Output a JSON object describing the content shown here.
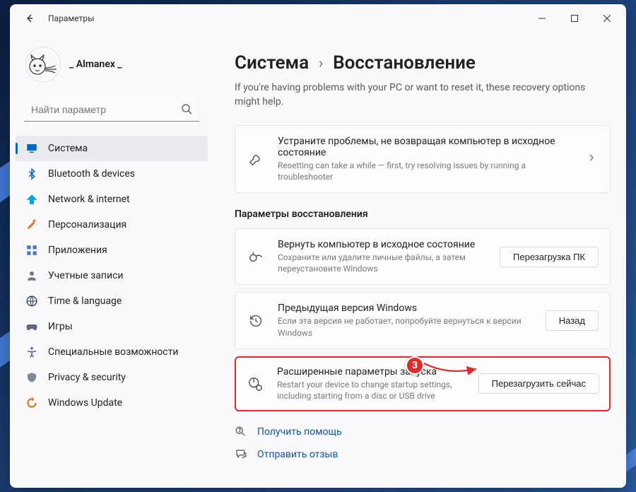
{
  "window": {
    "title": "Параметры",
    "profile_name": "_ Almanex _",
    "search_placeholder": "Найти параметр"
  },
  "sidebar": {
    "items": [
      {
        "icon": "system",
        "label": "Система",
        "active": true,
        "color": "#0067c0"
      },
      {
        "icon": "bluetooth",
        "label": "Bluetooth & devices",
        "color": "#0067c0"
      },
      {
        "icon": "wifi",
        "label": "Network & internet",
        "color": "#00a4e6"
      },
      {
        "icon": "brush",
        "label": "Персонализация",
        "color": "#d97b2f"
      },
      {
        "icon": "apps",
        "label": "Приложения",
        "color": "#4a74c9"
      },
      {
        "icon": "user",
        "label": "Учетные записи",
        "color": "#6b7b8f"
      },
      {
        "icon": "globe",
        "label": "Time & language",
        "color": "#3a4a6f"
      },
      {
        "icon": "game",
        "label": "Игры",
        "color": "#5c6b7a"
      },
      {
        "icon": "access",
        "label": "Специальные возможности",
        "color": "#5a6aa8"
      },
      {
        "icon": "shield",
        "label": "Privacy & security",
        "color": "#7a8a9a"
      },
      {
        "icon": "update",
        "label": "Windows Update",
        "color": "#d97b2f"
      }
    ]
  },
  "breadcrumb": {
    "root": "Система",
    "current": "Восстановление"
  },
  "subtitle": "If you're having problems with your PC or want to reset it, these recovery options might help.",
  "troubleshoot": {
    "title": "Устраните проблемы, не возвращая компьютер в исходное состояние",
    "desc": "Resetting can take a while — first, try resolving issues by running a troubleshooter"
  },
  "recovery_section_title": "Параметры восстановления",
  "cards": [
    {
      "title": "Вернуть компьютер в исходное состояние",
      "desc": "Сохраните или удалите личные файлы, а затем переустановите Windows",
      "button": "Перезагрузка ПК"
    },
    {
      "title": "Предыдущая версия Windows",
      "desc": "Если эта версия не работает, попробуйте вернуться к версии Windows",
      "button": "Назад"
    },
    {
      "title": "Расширенные параметры запуска",
      "desc": "Restart your device to change startup settings, including starting from a disc or USB drive",
      "button": "Перезагрузить сейчас"
    }
  ],
  "callout_number": "3",
  "links": {
    "help": "Получить помощь",
    "feedback": "Отправить отзыв"
  }
}
